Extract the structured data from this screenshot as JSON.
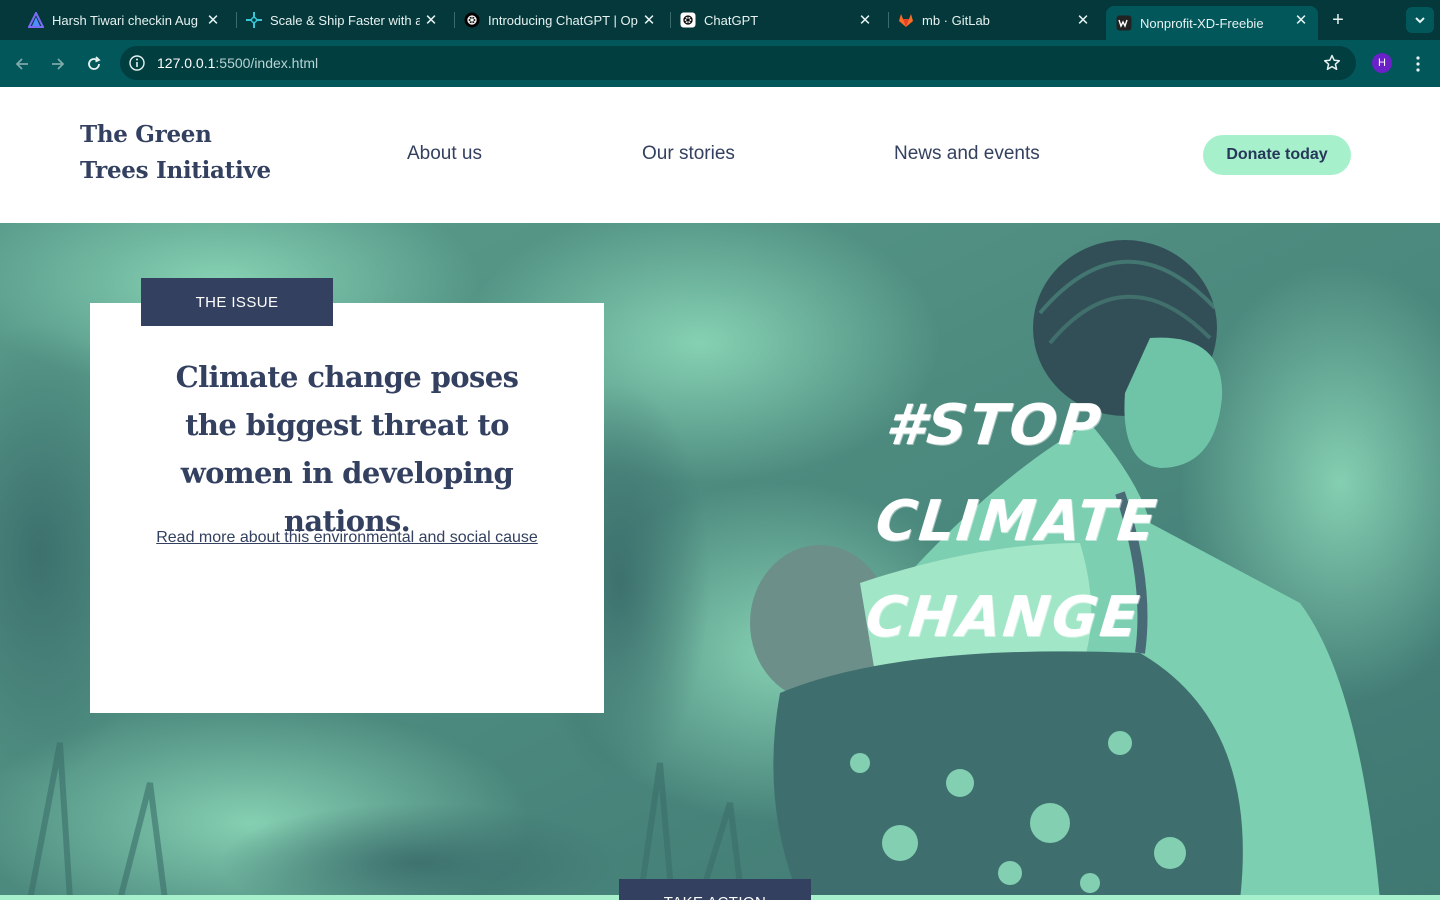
{
  "browser": {
    "tabs": [
      {
        "title": "Harsh Tiwari checkin Aug",
        "icon": "triangle-logo-icon"
      },
      {
        "title": "Scale & Ship Faster with a",
        "icon": "sparkle-logo-icon"
      },
      {
        "title": "Introducing ChatGPT | Op",
        "icon": "openai-logo-icon"
      },
      {
        "title": "ChatGPT",
        "icon": "openai-logo-icon"
      },
      {
        "title": "mb · GitLab",
        "icon": "gitlab-logo-icon"
      },
      {
        "title": "Nonprofit-XD-Freebie",
        "icon": "site-logo-icon"
      }
    ],
    "active_tab": 5,
    "url_host": "127.0.0.1",
    "url_rest": ":5500/index.html",
    "profile_initial": "H",
    "colors": {
      "tabstrip": "#04383a",
      "toolbar": "#02575b"
    }
  },
  "site": {
    "logo_line1": "The Green",
    "logo_line2": "Trees Initiative",
    "nav": [
      "About us",
      "Our stories",
      "News and events"
    ],
    "donate_label": "Donate today",
    "colors": {
      "navy": "#33405f",
      "mint": "#a7f0cc",
      "teal_photo": "#4e8f82"
    }
  },
  "hero": {
    "tag": "THE ISSUE",
    "headline": "Climate change poses the biggest threat to women in developing nations.",
    "link": "Read more about this environmental and social cause",
    "hashtag_line1": "#STOP",
    "hashtag_line2": "CLIMATE",
    "hashtag_line3": "CHANGE",
    "next_section_tag": "TAKE ACTION"
  }
}
